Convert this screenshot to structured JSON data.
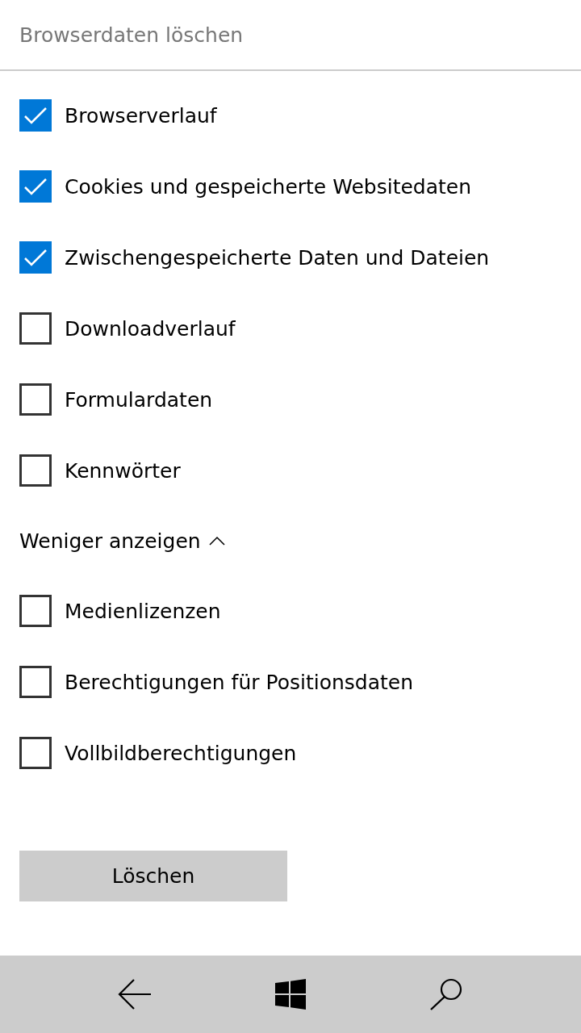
{
  "header": {
    "title": "Browserdaten löschen"
  },
  "options": [
    {
      "label": "Browserverlauf",
      "checked": true
    },
    {
      "label": "Cookies und gespeicherte Websitedaten",
      "checked": true
    },
    {
      "label": "Zwischengespeicherte Daten und Dateien",
      "checked": true
    },
    {
      "label": "Downloadverlauf",
      "checked": false
    },
    {
      "label": "Formulardaten",
      "checked": false
    },
    {
      "label": "Kennwörter",
      "checked": false
    }
  ],
  "more_toggle": {
    "label": "Weniger anzeigen",
    "expanded": true
  },
  "more_options": [
    {
      "label": "Medienlizenzen",
      "checked": false
    },
    {
      "label": "Berechtigungen für Positionsdaten",
      "checked": false
    },
    {
      "label": "Vollbildberechtigungen",
      "checked": false
    }
  ],
  "clear_button": {
    "label": "Löschen"
  }
}
